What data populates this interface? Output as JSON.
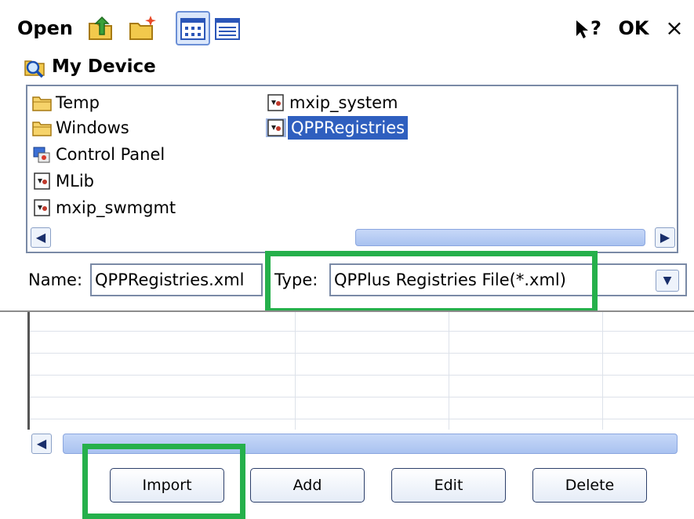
{
  "toolbar": {
    "title": "Open",
    "help_label": "?",
    "ok_label": "OK",
    "close_label": "×"
  },
  "location": {
    "label": "My Device"
  },
  "files": [
    {
      "label": "Temp",
      "icon": "folder-icon",
      "selected": false
    },
    {
      "label": "Windows",
      "icon": "folder-icon",
      "selected": false
    },
    {
      "label": "Control Panel",
      "icon": "control-panel-icon",
      "selected": false
    },
    {
      "label": "MLib",
      "icon": "app-file-icon",
      "selected": false
    },
    {
      "label": "mxip_swmgmt",
      "icon": "app-file-icon",
      "selected": false
    },
    {
      "label": "mxip_system",
      "icon": "app-file-icon",
      "selected": false
    },
    {
      "label": "QPPRegistries",
      "icon": "app-file-icon",
      "selected": true
    }
  ],
  "name_field": {
    "label": "Name:",
    "value": "QPPRegistries.xml"
  },
  "type_field": {
    "label": "Type:",
    "value": "QPPlus Registries File(*.xml)"
  },
  "buttons": {
    "import": "Import",
    "add": "Add",
    "edit": "Edit",
    "delete": "Delete"
  },
  "colors": {
    "highlight": "#25b04b",
    "selection": "#2f5fbf",
    "scroll_thumb": "#b3c9f3"
  }
}
